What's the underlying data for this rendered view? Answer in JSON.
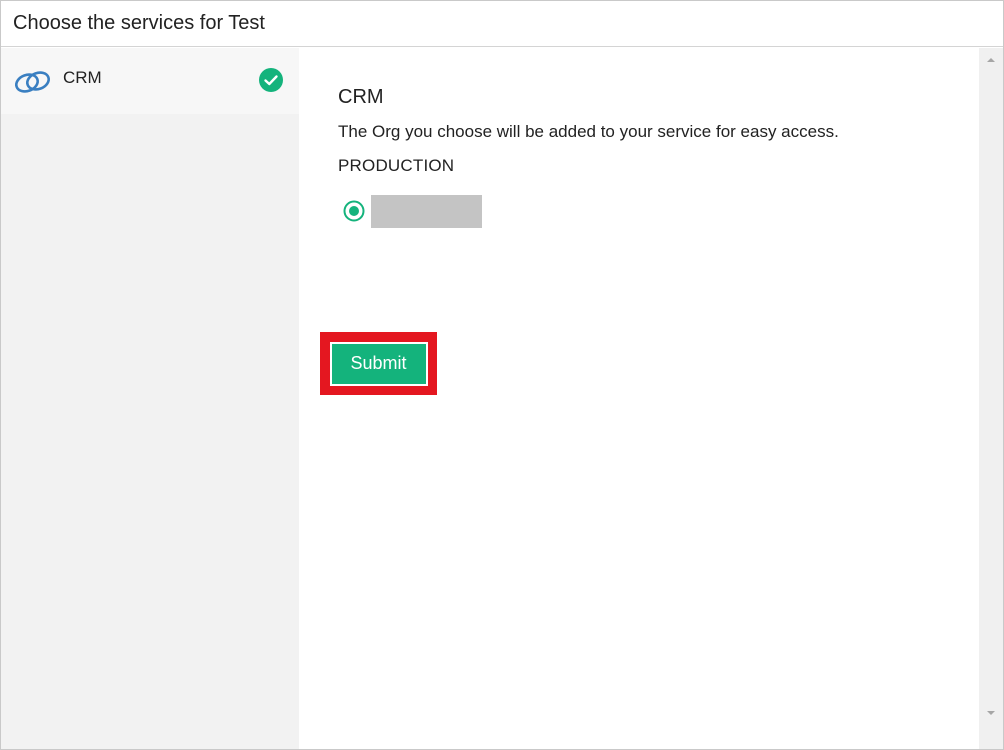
{
  "dialog": {
    "title": "Choose the services for Test"
  },
  "sidebar": {
    "items": [
      {
        "label": "CRM",
        "icon": "crm-link-icon",
        "status_icon": "check-circle-icon",
        "selected": true
      }
    ]
  },
  "main": {
    "section_title": "CRM",
    "description": "The Org you choose will be added to your service for easy access.",
    "environment_label": "PRODUCTION",
    "org_option": {
      "selected": true,
      "name_masked": true
    },
    "submit_label": "Submit"
  },
  "colors": {
    "accent": "#14b37c",
    "highlight_border": "#e41720",
    "icon_blue": "#3a7fc1",
    "sidebar_bg": "#f2f2f2",
    "masked_gray": "#c4c4c4"
  }
}
